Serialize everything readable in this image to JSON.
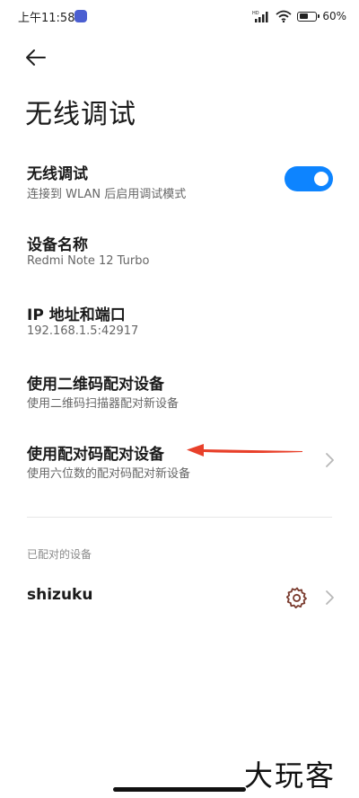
{
  "status_bar": {
    "time": "上午11:58",
    "battery_text": "60%",
    "battery_level": 0.6,
    "icons": [
      "hd-signal-icon",
      "wifi-icon",
      "battery-icon"
    ]
  },
  "header": {
    "back_icon": "back-arrow-icon",
    "title": "无线调试"
  },
  "settings": {
    "wireless_debugging": {
      "title": "无线调试",
      "subtitle": "连接到 WLAN 后启用调试模式",
      "enabled": true
    },
    "device_name": {
      "title": "设备名称",
      "value": "Redmi Note 12 Turbo"
    },
    "ip_port": {
      "title": "IP 地址和端口",
      "value": "192.168.1.5:42917"
    },
    "qr_pairing": {
      "title": "使用二维码配对设备",
      "subtitle": "使用二维码扫描器配对新设备"
    },
    "code_pairing": {
      "title": "使用配对码配对设备",
      "subtitle": "使用六位数的配对码配对新设备"
    }
  },
  "paired_devices": {
    "label": "已配对的设备",
    "items": [
      {
        "name": "shizuku"
      }
    ]
  },
  "watermark": "大玩客",
  "colors": {
    "accent": "#0d84ff",
    "annotation": "#e8402a",
    "gear": "#7a3b2e"
  }
}
